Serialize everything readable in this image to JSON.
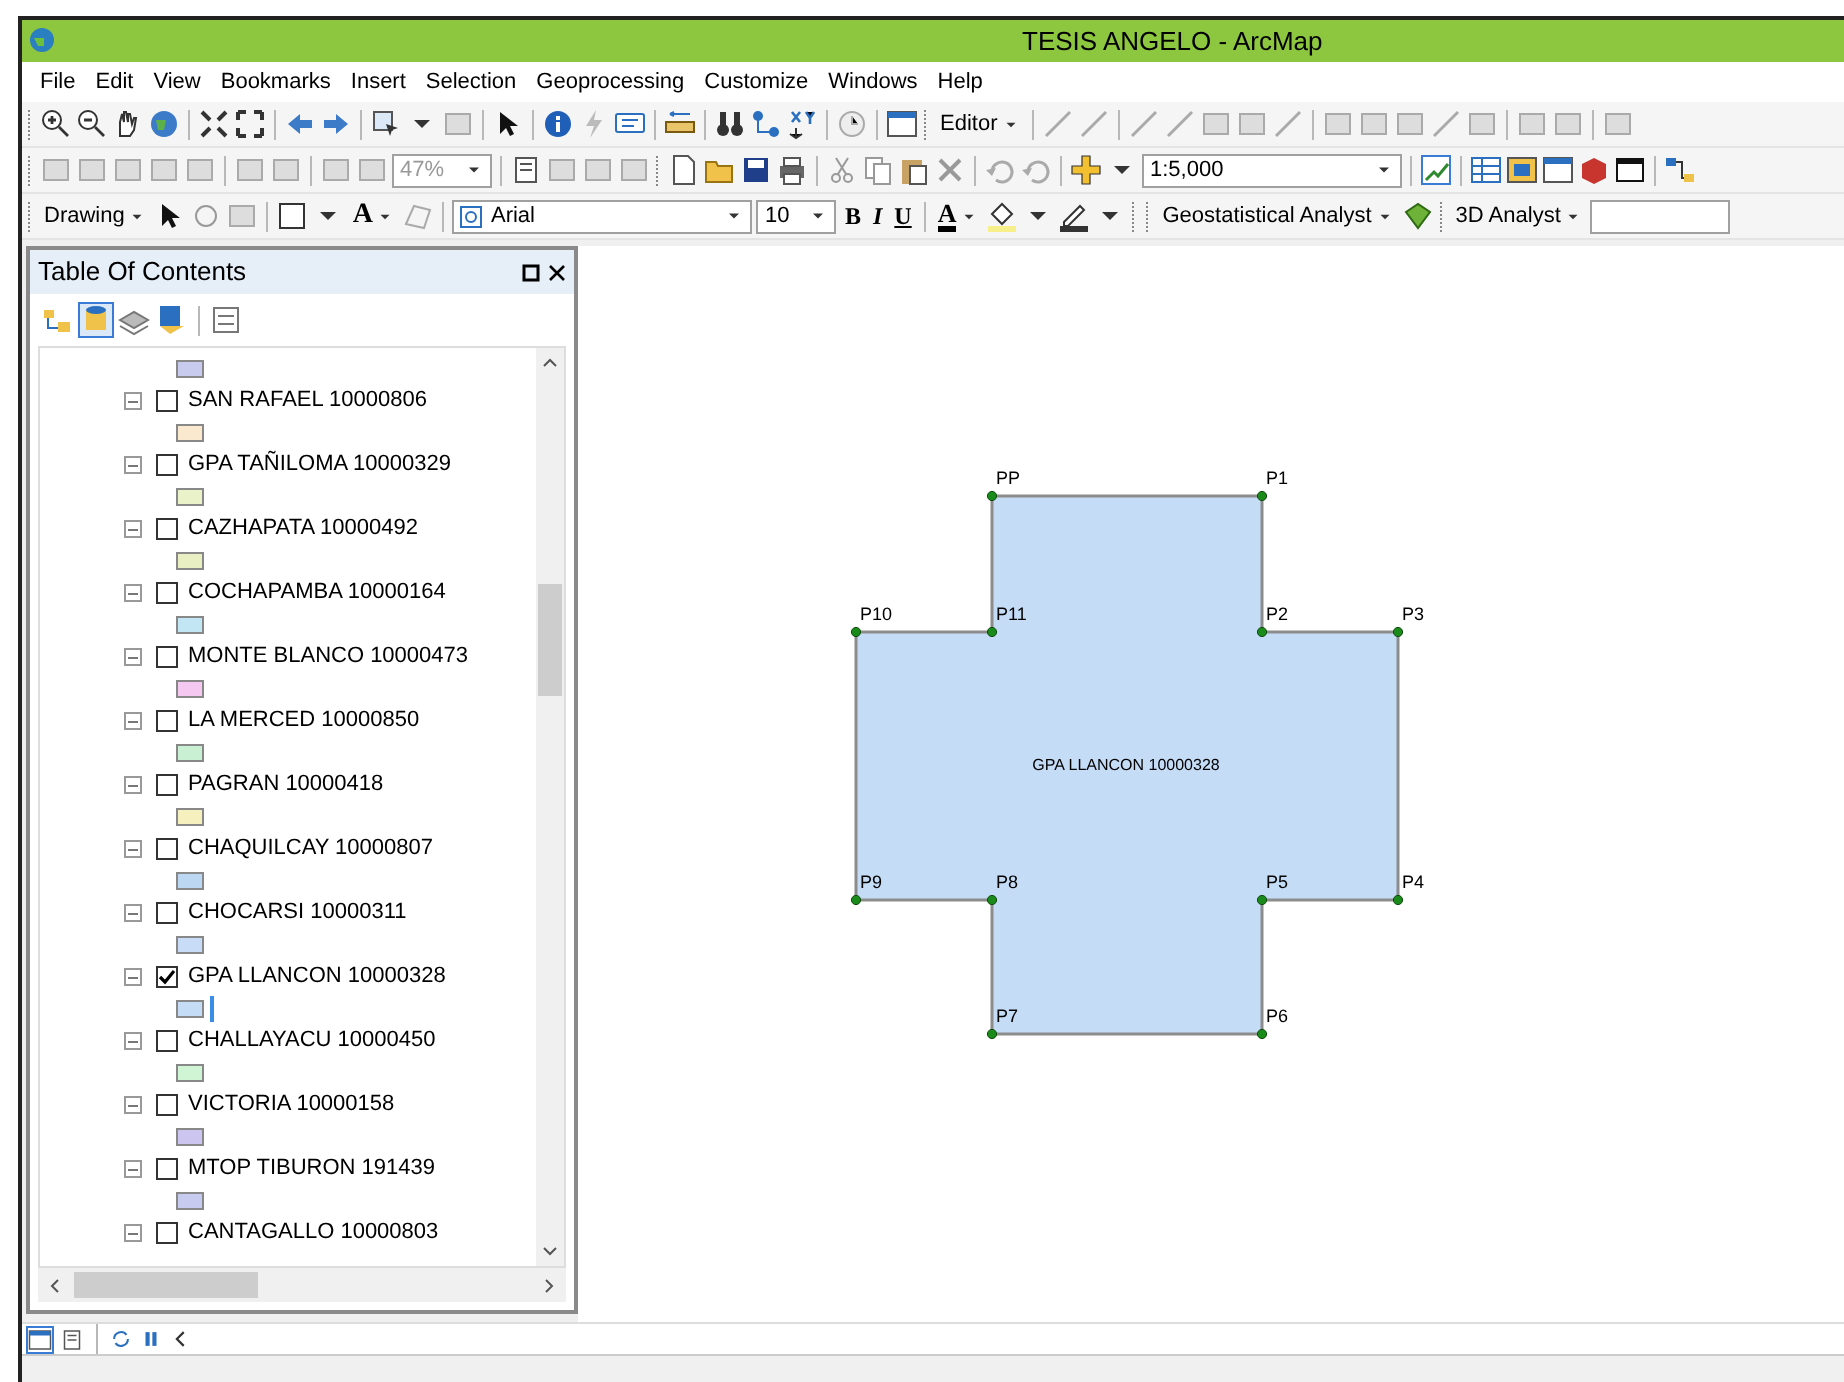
{
  "window": {
    "title": "TESIS ANGELO - ArcMap"
  },
  "menu": [
    "File",
    "Edit",
    "View",
    "Bookmarks",
    "Insert",
    "Selection",
    "Geoprocessing",
    "Customize",
    "Windows",
    "Help"
  ],
  "toolbars": {
    "editor_button": "Editor",
    "zoom_field": "47%",
    "scale_field": "1:5,000",
    "drawing_button": "Drawing",
    "font_field": "Arial",
    "size_field": "10",
    "bold_button": "B",
    "italic_button": "I",
    "underline_button": "U",
    "font_color_button": "A",
    "text_button": "A",
    "geostatistical_button": "Geostatistical Analyst",
    "analyst_3d_button": "3D Analyst"
  },
  "table_of_contents": {
    "title": "Table Of Contents",
    "leading_swatch": {
      "color": "#c8cbee"
    },
    "layers": [
      {
        "name": "SAN RAFAEL 10000806",
        "checked": false,
        "color": "#fbe9cf"
      },
      {
        "name": "GPA TAÑILOMA 10000329",
        "checked": false,
        "color": "#e9f2c8"
      },
      {
        "name": "CAZHAPATA 10000492",
        "checked": false,
        "color": "#e9efc3"
      },
      {
        "name": "COCHAPAMBA 10000164",
        "checked": false,
        "color": "#c3e6f5"
      },
      {
        "name": "MONTE BLANCO 10000473",
        "checked": false,
        "color": "#f5c8f2"
      },
      {
        "name": "LA MERCED 10000850",
        "checked": false,
        "color": "#c9f0d2"
      },
      {
        "name": "PAGRAN 10000418",
        "checked": false,
        "color": "#f5f0bd"
      },
      {
        "name": "CHAQUILCAY 10000807",
        "checked": false,
        "color": "#bcd7f2"
      },
      {
        "name": "CHOCARSI 10000311",
        "checked": false,
        "color": "#c9dcf7"
      },
      {
        "name": "GPA LLANCON 10000328",
        "checked": true,
        "color": "#c5dcf7"
      },
      {
        "name": "CHALLAYACU 10000450",
        "checked": false,
        "color": "#cff5d5"
      },
      {
        "name": "VICTORIA 10000158",
        "checked": false,
        "color": "#cbc5ef"
      },
      {
        "name": "MTOP TIBURON 191439",
        "checked": false,
        "color": "#c6cbef"
      },
      {
        "name": "CANTAGALLO 10000803",
        "checked": false
      }
    ]
  },
  "map": {
    "polygon_label": "GPA LLANCON 10000328",
    "points": [
      "PP",
      "P1",
      "P10",
      "P11",
      "P2",
      "P3",
      "P9",
      "P8",
      "P5",
      "P4",
      "P7",
      "P6"
    ]
  }
}
